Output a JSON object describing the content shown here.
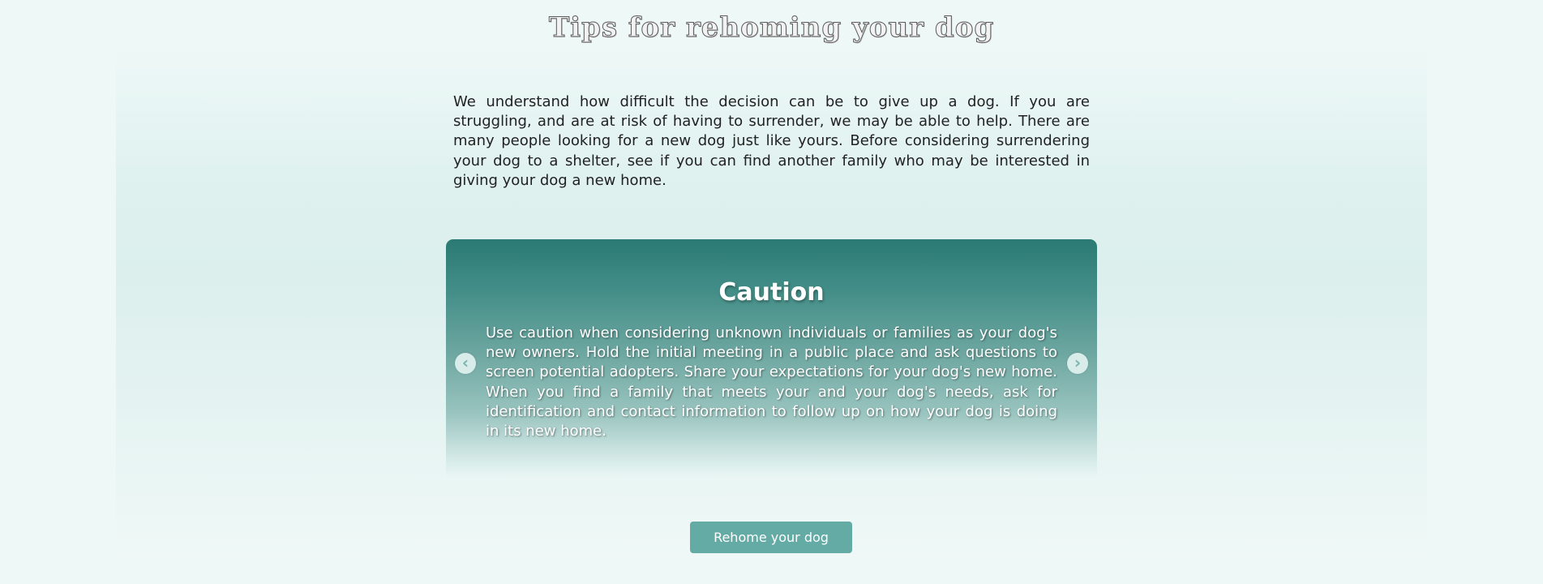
{
  "page": {
    "title": "Tips for rehoming your dog",
    "intro": "We understand how difficult the decision can be to give up a dog. If you are struggling, and are at risk of having to surrender, we may be able to help. There are many people looking for a new dog just like yours. Before considering surrendering your dog to a shelter, see if you can find another family who may be interested in giving your dog a new home."
  },
  "carousel": {
    "slide": {
      "title": "Caution",
      "text": "Use caution when considering unknown individuals or families as your dog's new owners. Hold the initial meeting in a public place and ask questions to screen potential adopters. Share your expectations for your dog's new home. When you find a family that meets your and your dog's needs, ask for identification and contact information to follow up on how your dog is doing in its new home."
    },
    "prev_icon": "chevron-left-icon",
    "next_icon": "chevron-right-icon",
    "prev_glyph": "‹",
    "next_glyph": "›"
  },
  "cta": {
    "label": "Rehome your dog"
  },
  "colors": {
    "carousel_top": "#2b7a74",
    "button": "#64aba5",
    "background": "#eef8f7"
  }
}
